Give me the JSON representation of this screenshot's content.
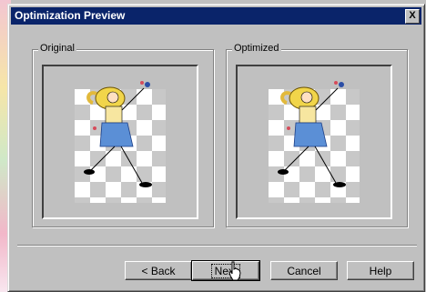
{
  "dialog": {
    "title": "Optimization Preview",
    "close_glyph": "X"
  },
  "groups": {
    "original_label": "Original",
    "optimized_label": "Optimized"
  },
  "buttons": {
    "back": "< Back",
    "next": "Next",
    "cancel": "Cancel",
    "help": "Help"
  },
  "icons": {
    "close": "close-icon",
    "cursor": "hand-pointer-icon"
  }
}
